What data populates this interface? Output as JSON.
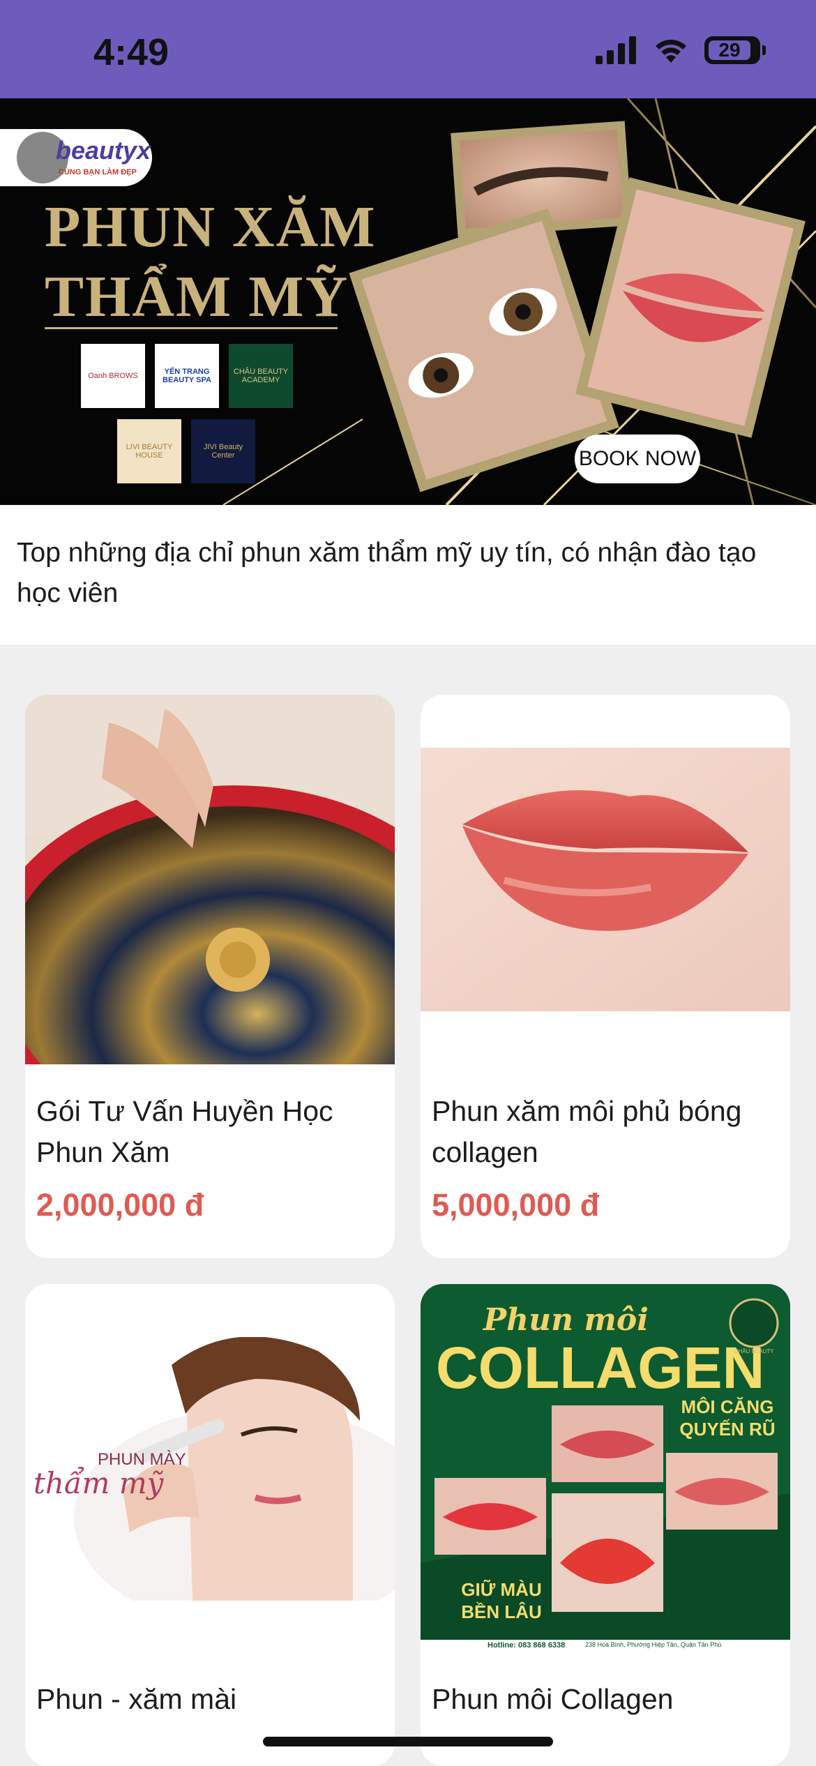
{
  "status_bar": {
    "time": "4:49",
    "battery_level": "29",
    "background": "#6e5cbc"
  },
  "banner": {
    "logo_text": "beautyx",
    "logo_tagline": "CÙNG BẠN LÀM ĐẸP",
    "title_line1": "PHUN XĂM",
    "title_line2": "THẨM MỸ",
    "brands": [
      "Oanh BROWS",
      "YẾN TRANG BEAUTY SPA",
      "CHÂU BEAUTY ACADEMY",
      "LIVI BEAUTY HOUSE",
      "JIVI Beauty Center"
    ],
    "cta_label": "BOOK NOW",
    "accent_color": "#c9b27c"
  },
  "description": "Top những địa chỉ phun xăm thẩm mỹ uy tín, có nhận đào tạo học viên",
  "products": [
    {
      "name": "Gói Tư Vấn Huyền Học Phun Xăm",
      "price": "2,000,000 đ",
      "image": "feng-shui-compass-photo"
    },
    {
      "name": "Phun xăm môi phủ bóng collagen",
      "price": "5,000,000 đ",
      "image": "lips-photo"
    },
    {
      "name": "Phun - xăm mài",
      "image": "eyebrow-tattoo-photo",
      "image_text_1": "PHUN MÀY",
      "image_text_2": "thẩm mỹ"
    },
    {
      "name": "Phun môi Collagen",
      "image": "collagen-lips-poster",
      "image_text_1": "Phun môi",
      "image_text_2": "COLLAGEN",
      "image_text_3": "MÔI CĂNG QUYẾN RŨ",
      "image_text_4": "GIỮ MÀU BỀN LÂU",
      "image_text_5": "CHÂU BEAUTY",
      "image_text_6": "Hotline: 083 868 6338",
      "image_text_7": "238 Hoà Bình, Phường Hiệp Tân, Quận Tân Phú"
    }
  ],
  "price_color": "#de5b52"
}
